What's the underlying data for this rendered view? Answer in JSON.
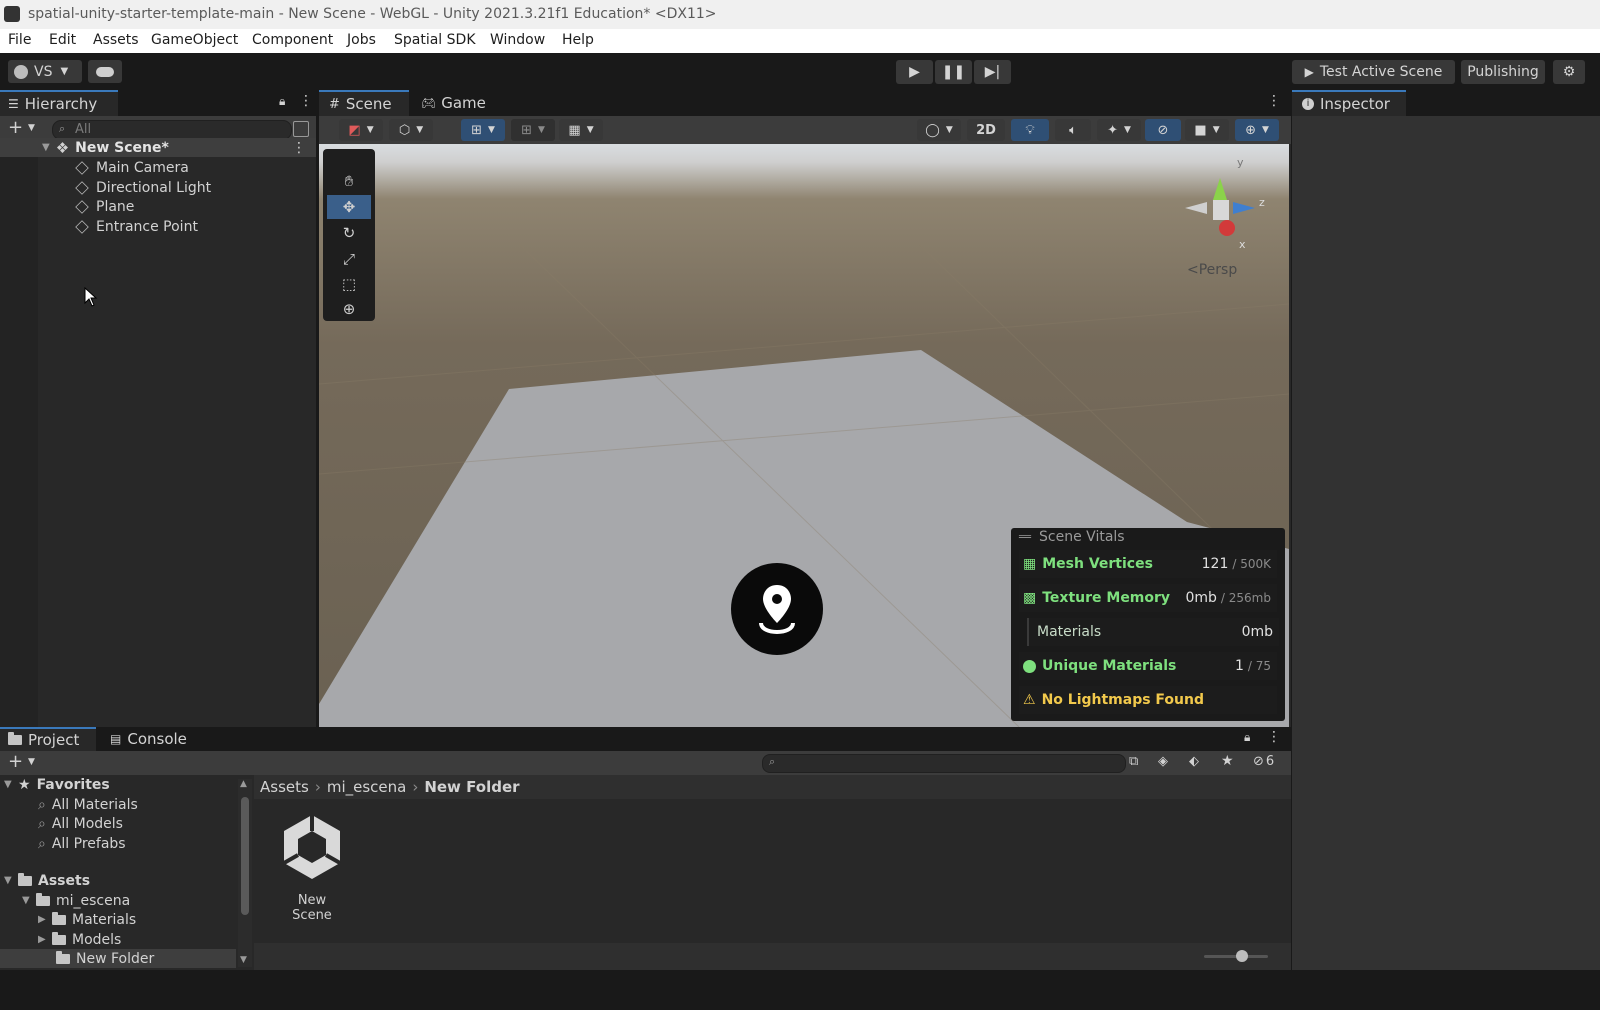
{
  "window": {
    "title": "spatial-unity-starter-template-main - New Scene - WebGL - Unity 2021.3.21f1 Education* <DX11>"
  },
  "menu": [
    "File",
    "Edit",
    "Assets",
    "GameObject",
    "Component",
    "Jobs",
    "Spatial SDK",
    "Window",
    "Help"
  ],
  "toolbar": {
    "account_label": "VS",
    "test_scene_label": "Test Active Scene",
    "publishing_label": "Publishing"
  },
  "hierarchy": {
    "tab_label": "Hierarchy",
    "search_placeholder": "All",
    "scene_name": "New Scene*",
    "items": [
      "Main Camera",
      "Directional Light",
      "Plane",
      "Entrance Point"
    ]
  },
  "scene_view": {
    "tabs": [
      "Scene",
      "Game"
    ],
    "mode_2d_label": "2D",
    "gizmo": {
      "y_label": "y",
      "z_label": "z",
      "x_label": "x",
      "projection_label": "Persp"
    }
  },
  "scene_vitals": {
    "title": "Scene Vitals",
    "rows": [
      {
        "label": "Mesh Vertices",
        "value": "121",
        "limit": "/ 500K"
      },
      {
        "label": "Texture Memory",
        "value": "0mb",
        "limit": "/ 256mb"
      },
      {
        "label": "Materials",
        "value": "0mb",
        "limit": ""
      },
      {
        "label": "Unique Materials",
        "value": "1",
        "limit": "/ 75"
      }
    ],
    "warning": "No Lightmaps Found",
    "colors": {
      "accent": "#7ee07e",
      "warning": "#f2c94c"
    }
  },
  "inspector": {
    "tab_label": "Inspector"
  },
  "project": {
    "tabs": [
      "Project",
      "Console"
    ],
    "favorites_label": "Favorites",
    "favorites": [
      "All Materials",
      "All Models",
      "All Prefabs"
    ],
    "assets_label": "Assets",
    "tree": {
      "mi_escena": "mi_escena",
      "materials": "Materials",
      "models": "Models",
      "new_folder": "New Folder"
    },
    "breadcrumb": [
      "Assets",
      "mi_escena",
      "New Folder"
    ],
    "hidden_count": "6",
    "grid_items": [
      {
        "name": "New Scene",
        "icon": "unity-scene-icon"
      }
    ]
  }
}
